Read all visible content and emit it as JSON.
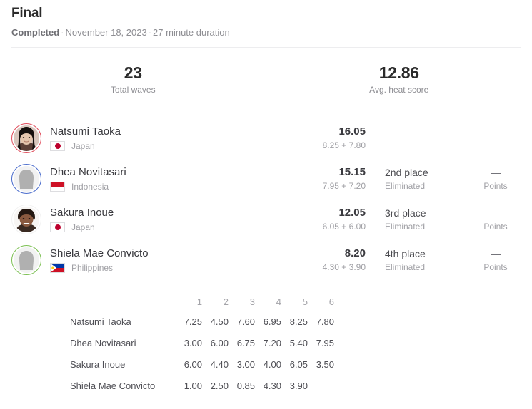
{
  "header": {
    "title": "Final",
    "status": "Completed",
    "date": "November 18, 2023",
    "duration": "27 minute duration",
    "separator": "·"
  },
  "stats": [
    {
      "value": "23",
      "label": "Total waves"
    },
    {
      "value": "12.86",
      "label": "Avg. heat score"
    }
  ],
  "athletes": [
    {
      "name": "Natsumi Taoka",
      "nation": "Japan",
      "flag": "jp",
      "ring_color": "#e04b5a",
      "avatar": "photo-dark-hair",
      "total": "16.05",
      "breakdown": "8.25 + 7.80",
      "place": "",
      "status": "",
      "points": "",
      "points_label": ""
    },
    {
      "name": "Dhea Novitasari",
      "nation": "Indonesia",
      "flag": "id",
      "ring_color": "#4a6ccc",
      "avatar": "placeholder",
      "total": "15.15",
      "breakdown": "7.95 + 7.20",
      "place": "2nd place",
      "status": "Eliminated",
      "points": "––",
      "points_label": "Points"
    },
    {
      "name": "Sakura Inoue",
      "nation": "Japan",
      "flag": "jp",
      "ring_color": "#ffffff",
      "avatar": "photo-smiling",
      "total": "12.05",
      "breakdown": "6.05 + 6.00",
      "place": "3rd place",
      "status": "Eliminated",
      "points": "––",
      "points_label": "Points"
    },
    {
      "name": "Shiela Mae Convicto",
      "nation": "Philippines",
      "flag": "ph",
      "ring_color": "#7bbf52",
      "avatar": "placeholder",
      "total": "8.20",
      "breakdown": "4.30 + 3.90",
      "place": "4th place",
      "status": "Eliminated",
      "points": "––",
      "points_label": "Points"
    }
  ],
  "waves_table": {
    "columns": [
      "1",
      "2",
      "3",
      "4",
      "5",
      "6"
    ],
    "rows": [
      {
        "name": "Natsumi Taoka",
        "scores": [
          "7.25",
          "4.50",
          "7.60",
          "6.95",
          "8.25",
          "7.80"
        ],
        "counted": [
          false,
          false,
          false,
          false,
          true,
          true
        ]
      },
      {
        "name": "Dhea Novitasari",
        "scores": [
          "3.00",
          "6.00",
          "6.75",
          "7.20",
          "5.40",
          "7.95"
        ],
        "counted": [
          false,
          false,
          false,
          true,
          false,
          true
        ]
      },
      {
        "name": "Sakura Inoue",
        "scores": [
          "6.00",
          "4.40",
          "3.00",
          "4.00",
          "6.05",
          "3.50"
        ],
        "counted": [
          true,
          false,
          false,
          false,
          true,
          false
        ]
      },
      {
        "name": "Shiela Mae Convicto",
        "scores": [
          "1.00",
          "2.50",
          "0.85",
          "4.30",
          "3.90",
          ""
        ],
        "counted": [
          false,
          false,
          false,
          true,
          true,
          false
        ]
      }
    ]
  },
  "colors": {
    "counted_score": "#f0a22e",
    "divider": "#ededef",
    "muted_text": "#a0a0a5"
  }
}
